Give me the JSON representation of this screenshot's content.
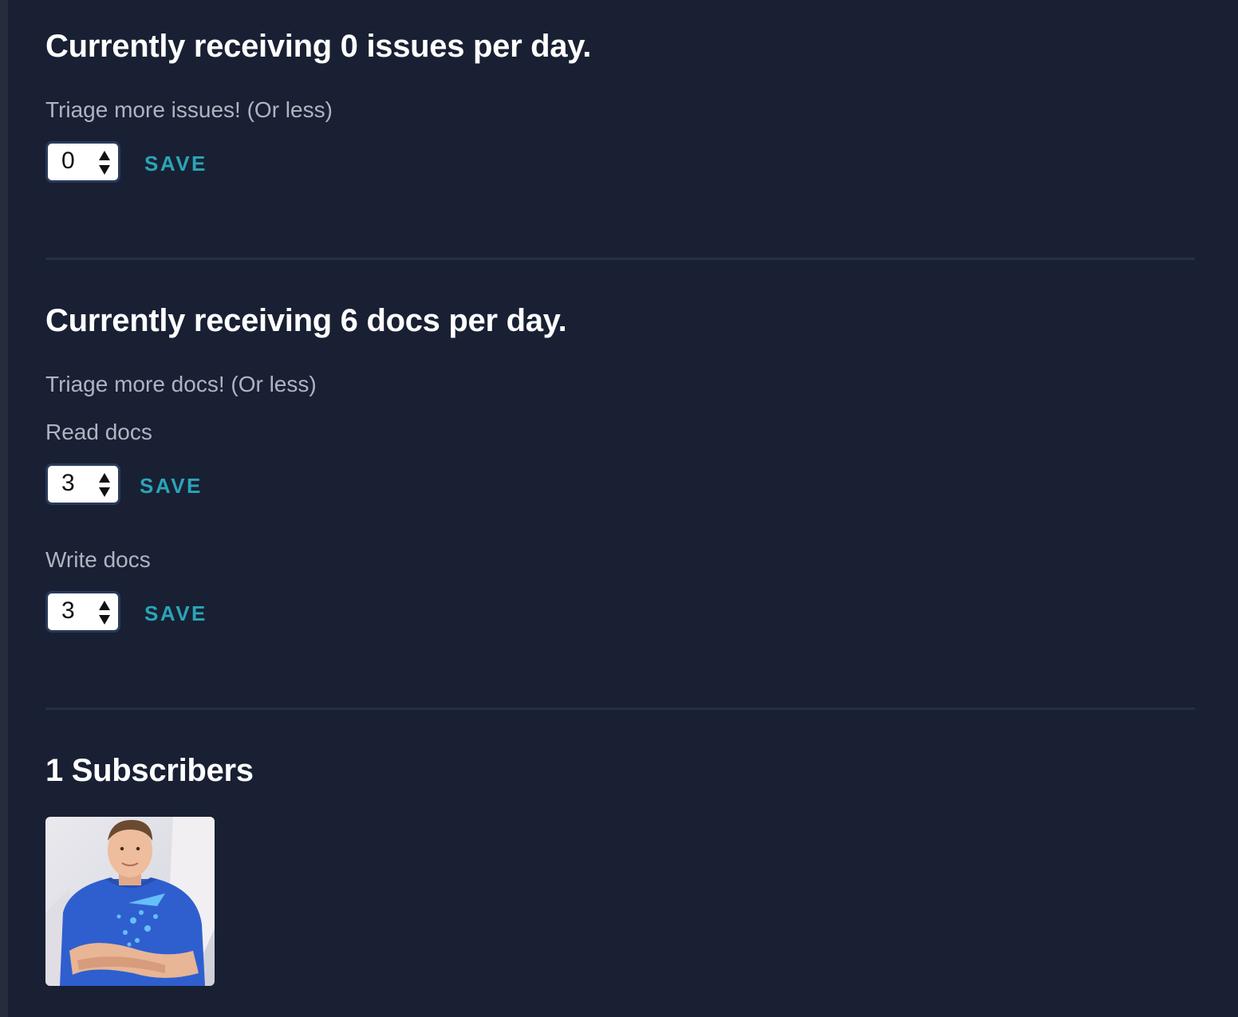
{
  "issues": {
    "heading": "Currently receiving 0 issues per day.",
    "subtext": "Triage more issues! (Or less)",
    "value": "0",
    "save_label": "SAVE"
  },
  "docs": {
    "heading": "Currently receiving 6 docs per day.",
    "subtext": "Triage more docs! (Or less)",
    "read": {
      "label": "Read docs",
      "value": "3",
      "save_label": "SAVE"
    },
    "write": {
      "label": "Write docs",
      "value": "3",
      "save_label": "SAVE"
    }
  },
  "subscribers": {
    "heading": "1 Subscribers"
  },
  "colors": {
    "background": "#192033",
    "accent": "#2aa5b8",
    "text": "#ffffff",
    "muted": "#aeb4c2"
  }
}
